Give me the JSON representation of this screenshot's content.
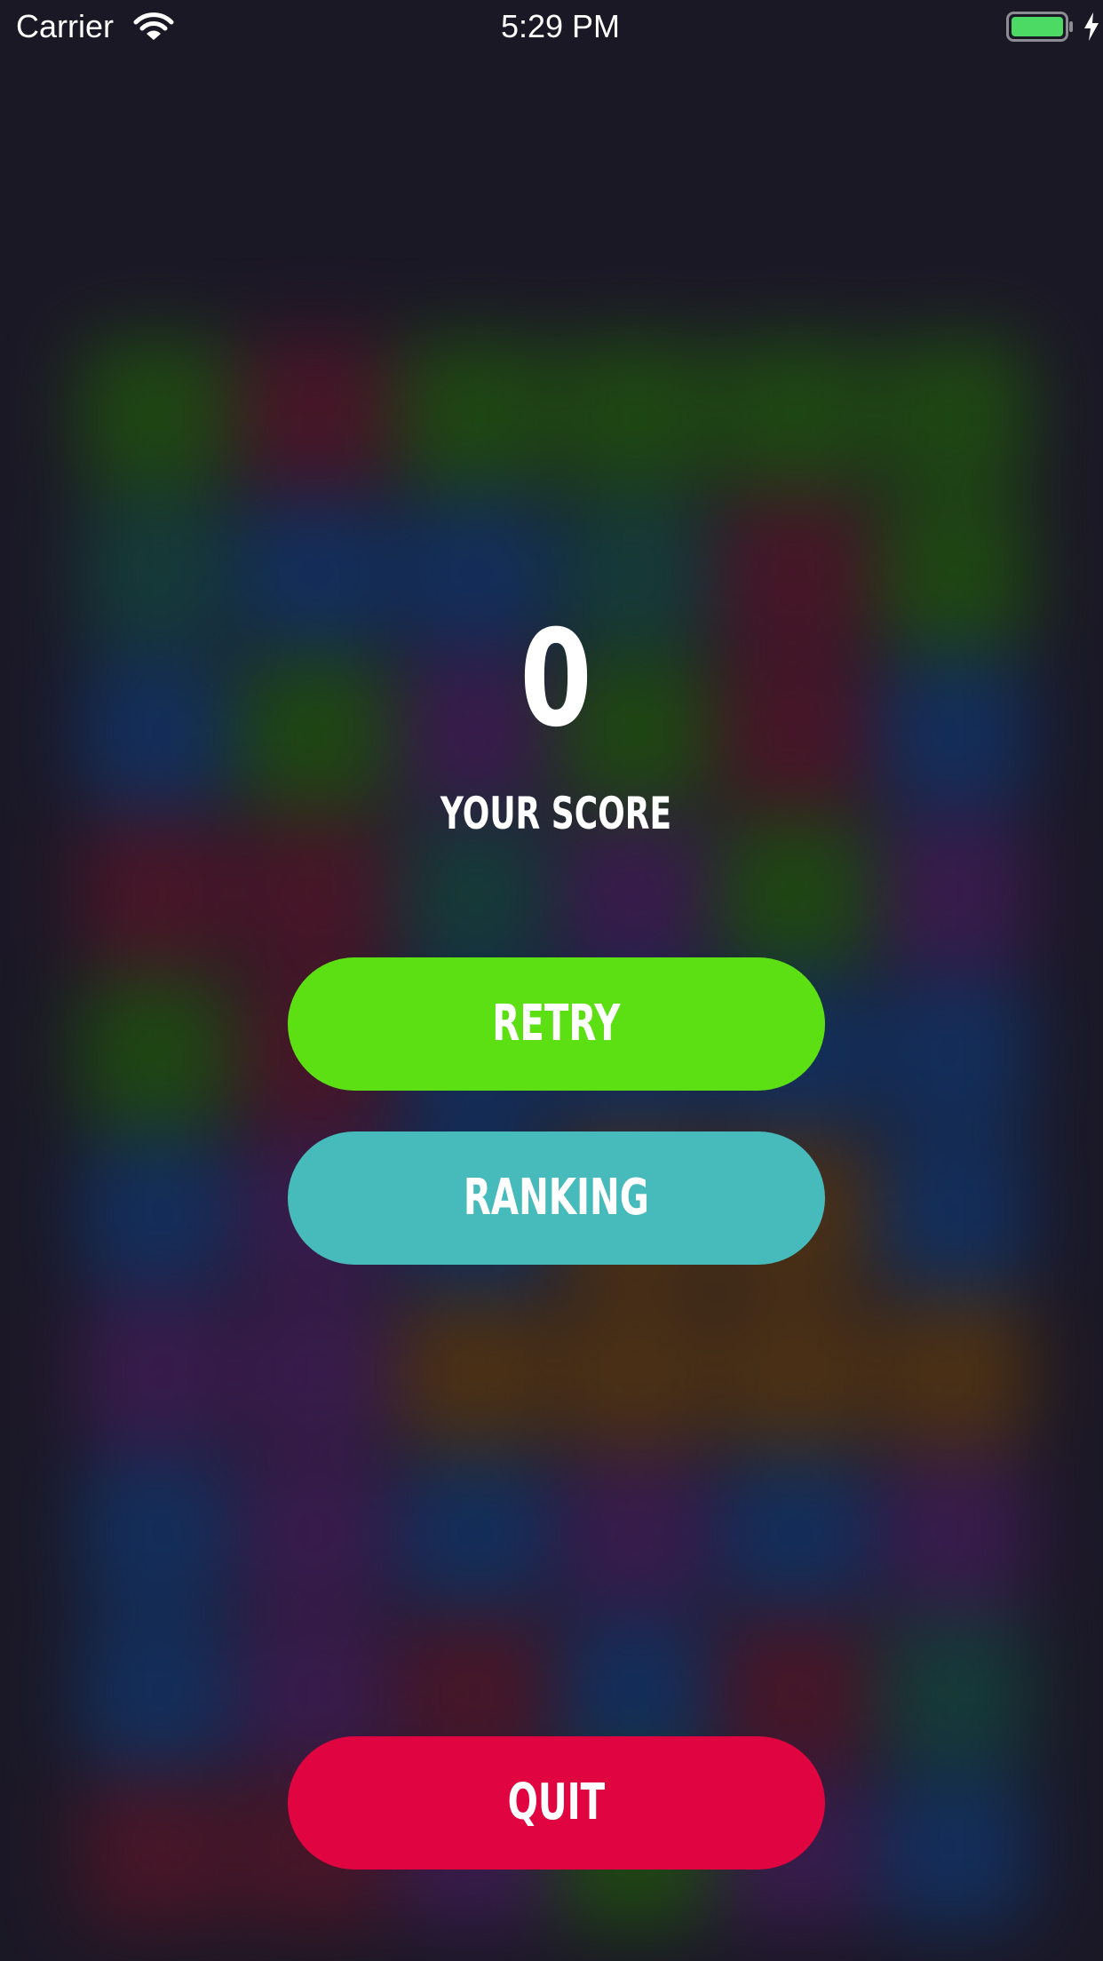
{
  "status_bar": {
    "carrier": "Carrier",
    "time": "5:29 PM",
    "icons": [
      "wifi-icon",
      "battery-icon",
      "charging-icon"
    ],
    "battery_color": "#4cd964"
  },
  "score": {
    "value": "0",
    "label": "YOUR SCORE"
  },
  "buttons": {
    "retry": {
      "label": "RETRY",
      "color": "#5ce014"
    },
    "ranking": {
      "label": "RANKING",
      "color": "#47bbbb"
    },
    "quit": {
      "label": "QUIT",
      "color": "#e00541"
    }
  },
  "theme": {
    "background": "#1b1826",
    "tile_colors": [
      "#1f4a12",
      "#4a1628",
      "#13305e",
      "#153c3a",
      "#3a1c4e",
      "#4e3214"
    ]
  }
}
